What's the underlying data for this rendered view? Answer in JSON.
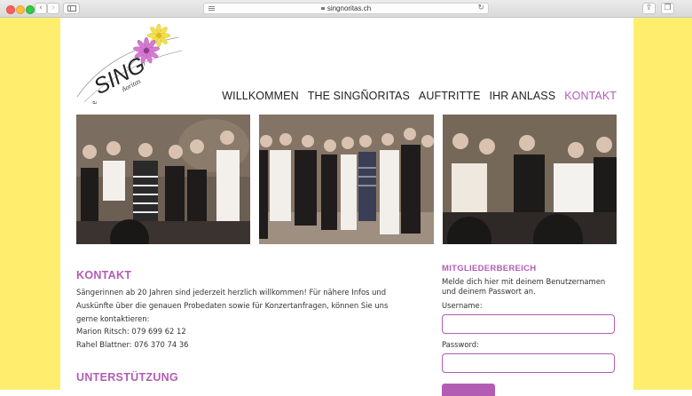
{
  "browser": {
    "url": "singnoritas.ch"
  },
  "logo": {
    "word_the": "the",
    "word_sing": "SING",
    "word_noritas": "ñoritas"
  },
  "nav": {
    "items": [
      "WILLKOMMEN",
      "THE SINGÑORITAS",
      "AUFTRITTE",
      "IHR ANLASS",
      "KONTAKT"
    ],
    "active": "KONTAKT"
  },
  "colors": {
    "accent": "#b35cb4",
    "side_background": "#ffee6e"
  },
  "kontakt": {
    "title": "KONTAKT",
    "text": "Sängerinnen ab 20 Jahren sind jederzeit herzlich willkommen! Für nähere Infos und Auskünfte über die genauen Probedaten sowie für Konzertanfragen, können Sie uns gerne kontaktieren:",
    "contact1": "Marion Ritsch: 079 699 62 12",
    "contact2": "Rahel Blattner: 076 370 74 36"
  },
  "support": {
    "title": "UNTERSTÜTZUNG"
  },
  "members": {
    "title": "MITGLIEDERBEREICH",
    "text": "Melde dich hier mit deinem Benutzernamen und deinem Passwort an.",
    "username_label": "Username:",
    "password_label": "Password:"
  }
}
